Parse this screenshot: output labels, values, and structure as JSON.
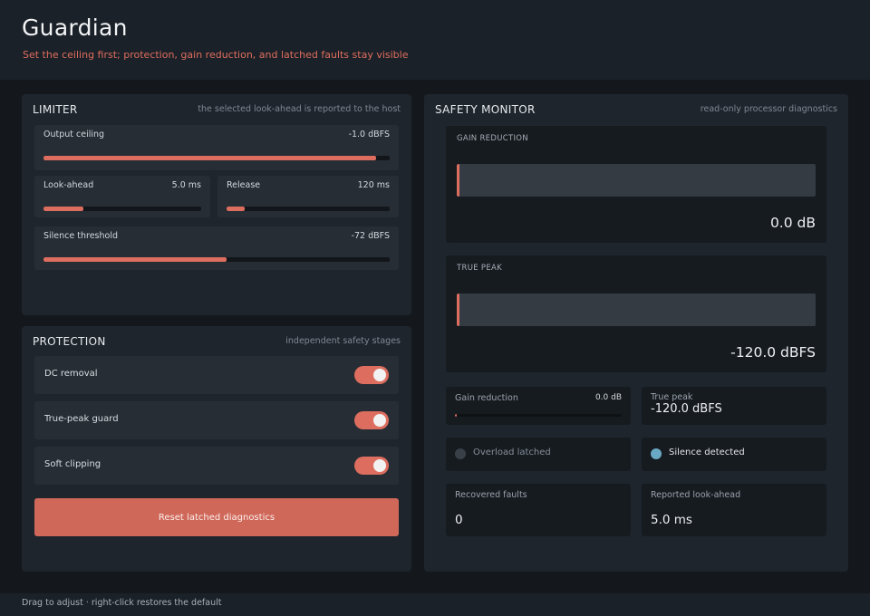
{
  "app": {
    "title": "Guardian",
    "subtitle": "Set the ceiling first; protection, gain reduction, and latched faults stay visible"
  },
  "limiter": {
    "title": "LIMITER",
    "note": "the selected look-ahead is reported to the host",
    "output_ceiling": {
      "label": "Output ceiling",
      "value": "-1.0 dBFS",
      "level": 0.96
    },
    "lookahead": {
      "label": "Look-ahead",
      "value": "5.0 ms",
      "level": 0.25
    },
    "release": {
      "label": "Release",
      "value": "120 ms",
      "level": 0.11
    },
    "silence_threshold": {
      "label": "Silence threshold",
      "value": "-72 dBFS",
      "level": 0.53
    }
  },
  "protection": {
    "title": "PROTECTION",
    "note": "independent safety stages",
    "toggles": [
      {
        "label": "DC removal",
        "on": true
      },
      {
        "label": "True-peak guard",
        "on": true
      },
      {
        "label": "Soft clipping",
        "on": true
      }
    ],
    "reset_label": "Reset latched diagnostics"
  },
  "monitor": {
    "title": "SAFETY MONITOR",
    "note": "read-only processor diagnostics",
    "gain_reduction_meter": {
      "label": "GAIN REDUCTION",
      "value": "0.0 dB",
      "level": 0.0
    },
    "true_peak_meter": {
      "label": "TRUE PEAK",
      "value": "-120.0 dBFS",
      "level": 0.0
    },
    "gr_tile": {
      "label": "Gain reduction",
      "value": "0.0 dB",
      "level": 0.0
    },
    "tp_tile": {
      "label": "True peak",
      "value": "-120.0 dBFS"
    },
    "overload": {
      "label": "Overload latched",
      "active": false
    },
    "silence": {
      "label": "Silence detected",
      "active": true
    },
    "recovered_faults": {
      "label": "Recovered faults",
      "value": "0"
    },
    "reported_lookahead": {
      "label": "Reported look-ahead",
      "value": "5.0 ms"
    }
  },
  "colors": {
    "accent": "#dd6e5f",
    "led_on": "#6aa9c4",
    "led_off": "#3a4048"
  },
  "footer": {
    "hint": "Drag to adjust · right-click restores the default"
  }
}
